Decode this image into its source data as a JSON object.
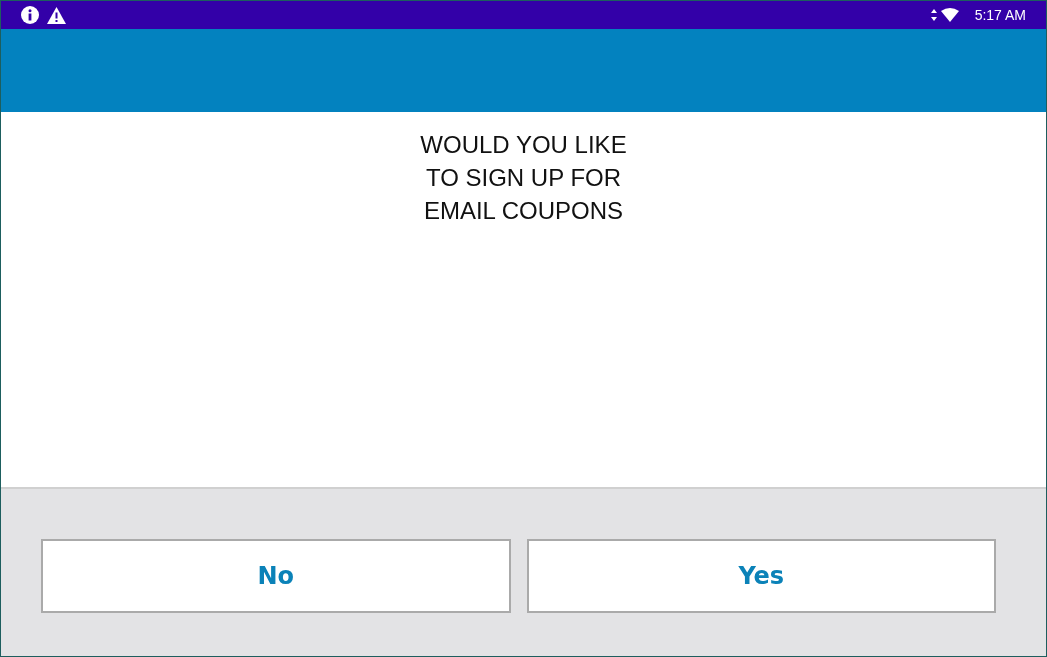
{
  "status_bar": {
    "time": "5:17 AM"
  },
  "prompt": {
    "lines": [
      "WOULD YOU LIKE",
      "TO SIGN UP FOR",
      "EMAIL COUPONS"
    ]
  },
  "buttons": [
    {
      "label": "No"
    },
    {
      "label": "Yes"
    }
  ]
}
